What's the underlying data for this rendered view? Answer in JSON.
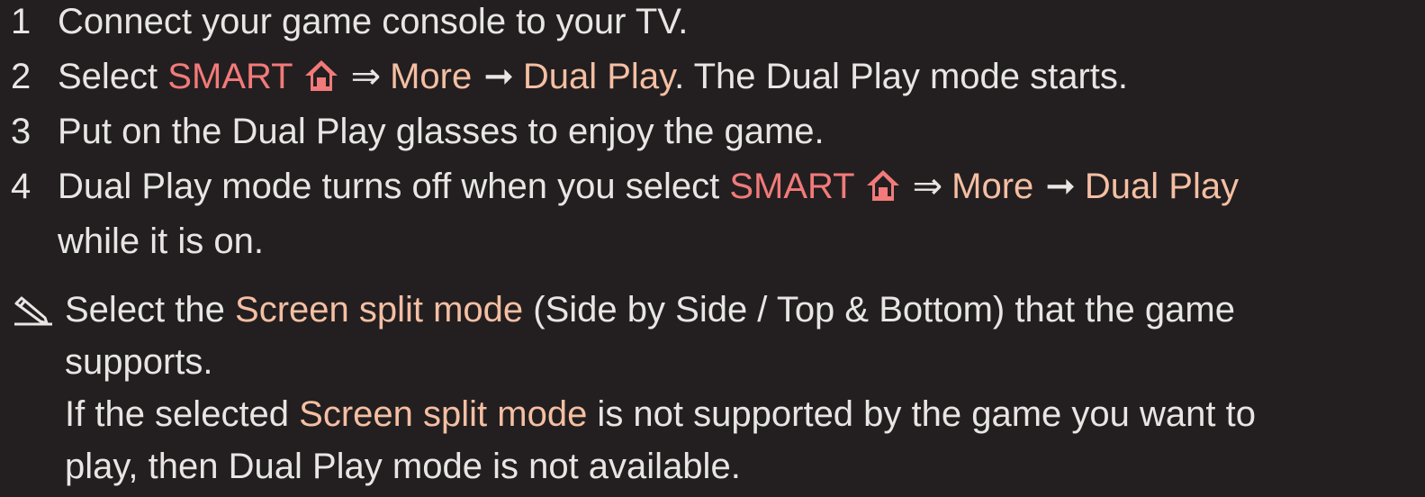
{
  "steps": [
    {
      "num": "1",
      "text": "Connect your game console to your TV."
    },
    {
      "num": "2",
      "pre": "Select ",
      "smart": "SMART",
      "dbl_arrow": "⇒",
      "more": "More",
      "arrow": "➞",
      "dual_play": "Dual Play",
      "post": ". The Dual Play mode starts."
    },
    {
      "num": "3",
      "text": "Put on the Dual Play glasses to enjoy the game."
    },
    {
      "num": "4",
      "pre": "Dual Play mode turns off when you select ",
      "smart": "SMART",
      "dbl_arrow": "⇒",
      "more": "More",
      "arrow": "➞",
      "dual_play": "Dual Play",
      "line2": "while it is on."
    }
  ],
  "note": {
    "icon": "pencil-note-icon",
    "p1_pre": "Select the ",
    "p1_hl": "Screen split mode",
    "p1_post": " (Side by Side / Top & Bottom) that the game",
    "p1_line2": "supports.",
    "p2_pre": "If the selected ",
    "p2_hl": "Screen split mode",
    "p2_post": " is not supported by the game you want to",
    "p2_line2": "play, then Dual Play mode is not available."
  },
  "colors": {
    "background": "#231f20",
    "text": "#e8e6e5",
    "smart": "#f27a7a",
    "menu_item": "#f5bfa3"
  },
  "icons": {
    "home": "home-icon"
  }
}
